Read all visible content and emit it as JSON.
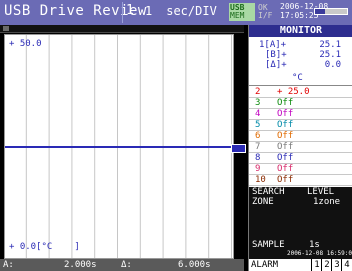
{
  "header": {
    "title": "USB Drive Review",
    "page": "1",
    "time_div": "sec/DIV",
    "usb_badge_top": "USB",
    "usb_badge_bottom": "MEM",
    "ok_badge_top": "OK",
    "ok_badge_bottom": "I/F",
    "date": "2006-12-08",
    "time": "17:05:25"
  },
  "plot": {
    "y_top_label": "50.0",
    "y_bottom_label": "0.0[°C",
    "y_bottom_bracket": "]",
    "trace_color": "#2a2ab5"
  },
  "status": {
    "a_label": "A:",
    "a_value": "2.000s",
    "delta_label": "Δ:",
    "delta_value": "6.000s"
  },
  "monitor": {
    "title": "MONITOR",
    "summary": [
      {
        "label": "1[A]+",
        "value": "25.1"
      },
      {
        "label": "[B]+",
        "value": "25.1"
      },
      {
        "label": "[Δ]+",
        "value": "0.0"
      }
    ],
    "unit": "°C",
    "channels": [
      {
        "num": "2",
        "value": "+ 25.0",
        "color": "#e00000"
      },
      {
        "num": "3",
        "value": "Off",
        "color": "#0a8a0a"
      },
      {
        "num": "4",
        "value": "Off",
        "color": "#c000c0"
      },
      {
        "num": "5",
        "value": "Off",
        "color": "#008aa8"
      },
      {
        "num": "6",
        "value": "Off",
        "color": "#e06a00"
      },
      {
        "num": "7",
        "value": "Off",
        "color": "#7a7a7a"
      },
      {
        "num": "8",
        "value": "Off",
        "color": "#2a2ab5"
      },
      {
        "num": "9",
        "value": "Off",
        "color": "#d82a6a"
      },
      {
        "num": "10",
        "value": "Off",
        "color": "#8a2a00"
      }
    ],
    "search": "SEARCH",
    "level": "LEVEL",
    "zone": "ZONE",
    "zone_value": "1zone",
    "sample_label": "SAMPLE",
    "sample_value": "1s",
    "sample_datetime": "2006-12-08 16:59:0",
    "alarm_label": "ALARM",
    "alarm_buttons": [
      "1",
      "2",
      "3",
      "4"
    ]
  }
}
